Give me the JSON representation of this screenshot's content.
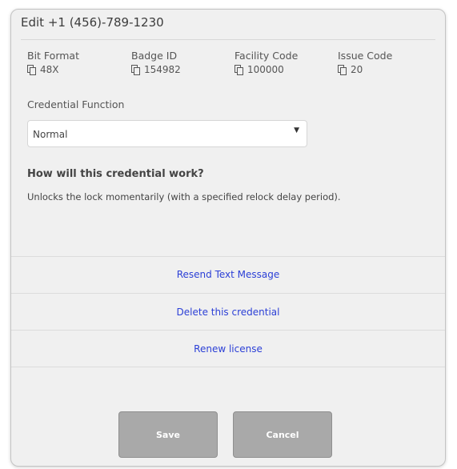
{
  "dialog": {
    "title": "Edit +1 (456)-789-1230",
    "fields": [
      {
        "label": "Bit Format",
        "value": "48X",
        "icon": "copy-icon"
      },
      {
        "label": "Badge ID",
        "value": "154982",
        "icon": "copy-icon"
      },
      {
        "label": "Facility Code",
        "value": "100000",
        "icon": "copy-icon"
      },
      {
        "label": "Issue Code",
        "value": "20",
        "icon": "copy-icon"
      }
    ],
    "credential_function": {
      "label": "Credential Function",
      "selected": "Normal",
      "caret": "▼"
    },
    "how_it_works": {
      "heading": "How will this credential work?",
      "text": "Unlocks the lock momentarily (with a specified relock delay period)."
    },
    "actions": {
      "resend": "Resend Text Message",
      "delete": "Delete this credential",
      "renew": "Renew license"
    },
    "buttons": {
      "save": "Save",
      "cancel": "Cancel"
    },
    "colors": {
      "link": "#2b3fd6",
      "button_bg": "#a9a9a9",
      "dialog_bg": "#f0f0f0"
    }
  }
}
